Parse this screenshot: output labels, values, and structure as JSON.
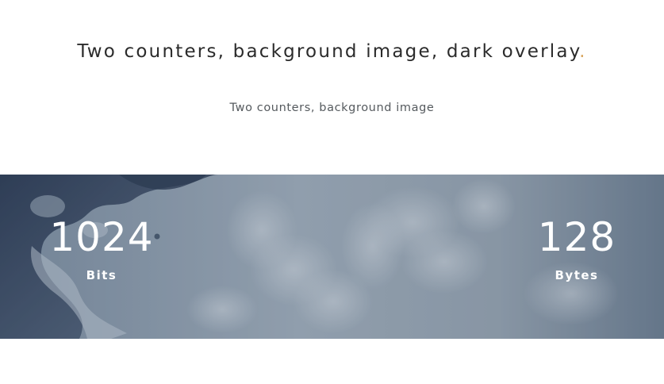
{
  "header": {
    "title": "Two counters, background image, dark overlay",
    "title_dot": ".",
    "subtitle": "Two counters, background image"
  },
  "counters": [
    {
      "value": "1024",
      "label": "Bits"
    },
    {
      "value": "128",
      "label": "Bytes"
    }
  ],
  "colors": {
    "accent_dot": "#d9a65f",
    "title_text": "#2b2b2b",
    "overlay": "#3a4d63"
  }
}
